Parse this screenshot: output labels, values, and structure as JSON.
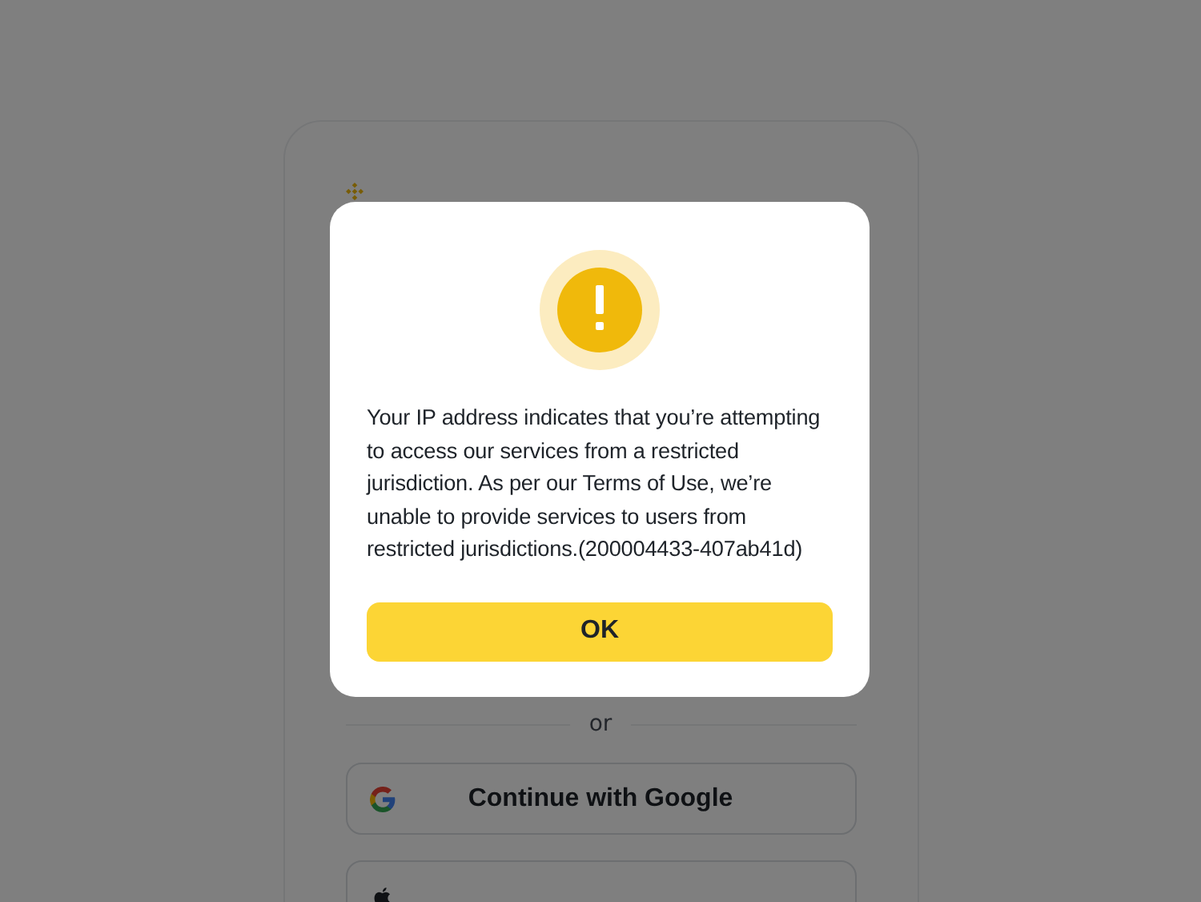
{
  "page": {
    "divider": "or",
    "buttons": [
      {
        "kind": "google",
        "label": "Continue with Google"
      },
      {
        "kind": "apple"
      }
    ]
  },
  "dialog": {
    "message": "Your IP address indicates that you’re attempting to access our services from a restricted jurisdiction. As per our Terms of Use, we’re unable to provide services to users from restricted jurisdictions.(200004433-407ab41d)",
    "button": "OK"
  }
}
